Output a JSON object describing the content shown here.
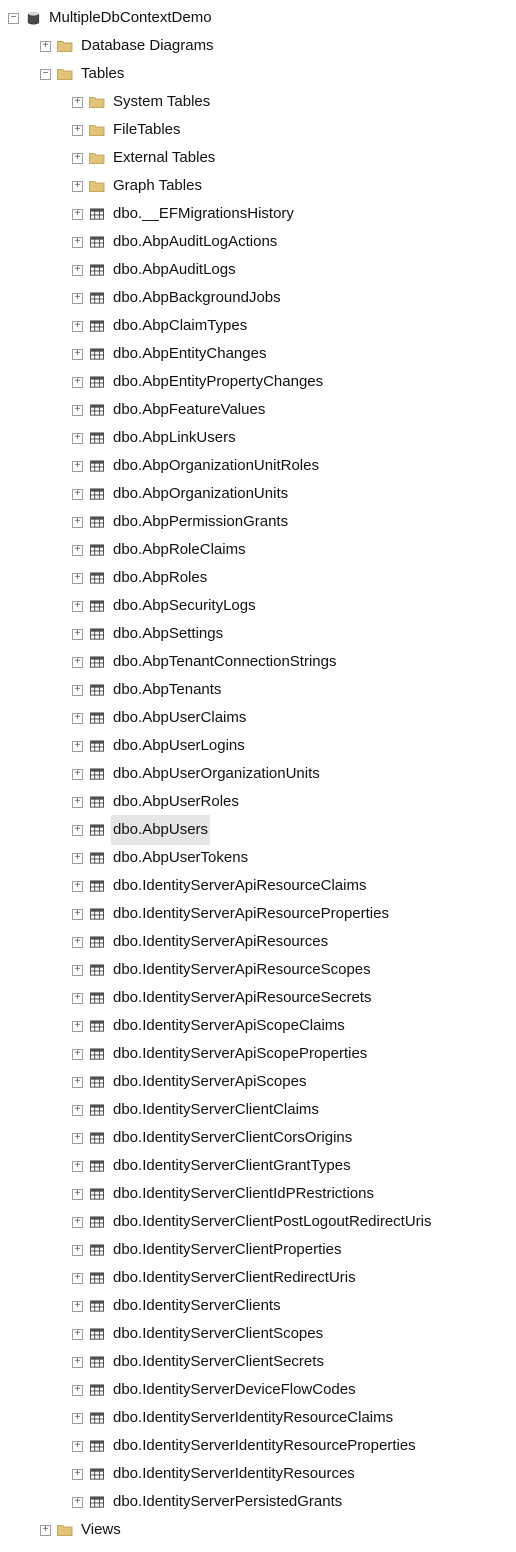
{
  "root": {
    "label": "MultipleDbContextDemo",
    "expanded": true,
    "icon": "database"
  },
  "level1": [
    {
      "label": "Database Diagrams",
      "icon": "folder",
      "expanded": false
    },
    {
      "label": "Tables",
      "icon": "folder",
      "expanded": true
    },
    {
      "label": "Views",
      "icon": "folder",
      "expanded": false
    }
  ],
  "tables_children": [
    {
      "label": "System Tables",
      "icon": "folder"
    },
    {
      "label": "FileTables",
      "icon": "folder"
    },
    {
      "label": "External Tables",
      "icon": "folder"
    },
    {
      "label": "Graph Tables",
      "icon": "folder"
    },
    {
      "label": "dbo.__EFMigrationsHistory",
      "icon": "table"
    },
    {
      "label": "dbo.AbpAuditLogActions",
      "icon": "table"
    },
    {
      "label": "dbo.AbpAuditLogs",
      "icon": "table"
    },
    {
      "label": "dbo.AbpBackgroundJobs",
      "icon": "table"
    },
    {
      "label": "dbo.AbpClaimTypes",
      "icon": "table"
    },
    {
      "label": "dbo.AbpEntityChanges",
      "icon": "table"
    },
    {
      "label": "dbo.AbpEntityPropertyChanges",
      "icon": "table"
    },
    {
      "label": "dbo.AbpFeatureValues",
      "icon": "table"
    },
    {
      "label": "dbo.AbpLinkUsers",
      "icon": "table"
    },
    {
      "label": "dbo.AbpOrganizationUnitRoles",
      "icon": "table"
    },
    {
      "label": "dbo.AbpOrganizationUnits",
      "icon": "table"
    },
    {
      "label": "dbo.AbpPermissionGrants",
      "icon": "table"
    },
    {
      "label": "dbo.AbpRoleClaims",
      "icon": "table"
    },
    {
      "label": "dbo.AbpRoles",
      "icon": "table"
    },
    {
      "label": "dbo.AbpSecurityLogs",
      "icon": "table"
    },
    {
      "label": "dbo.AbpSettings",
      "icon": "table"
    },
    {
      "label": "dbo.AbpTenantConnectionStrings",
      "icon": "table"
    },
    {
      "label": "dbo.AbpTenants",
      "icon": "table"
    },
    {
      "label": "dbo.AbpUserClaims",
      "icon": "table"
    },
    {
      "label": "dbo.AbpUserLogins",
      "icon": "table"
    },
    {
      "label": "dbo.AbpUserOrganizationUnits",
      "icon": "table"
    },
    {
      "label": "dbo.AbpUserRoles",
      "icon": "table"
    },
    {
      "label": "dbo.AbpUsers",
      "icon": "table",
      "selected": true
    },
    {
      "label": "dbo.AbpUserTokens",
      "icon": "table"
    },
    {
      "label": "dbo.IdentityServerApiResourceClaims",
      "icon": "table"
    },
    {
      "label": "dbo.IdentityServerApiResourceProperties",
      "icon": "table"
    },
    {
      "label": "dbo.IdentityServerApiResources",
      "icon": "table"
    },
    {
      "label": "dbo.IdentityServerApiResourceScopes",
      "icon": "table"
    },
    {
      "label": "dbo.IdentityServerApiResourceSecrets",
      "icon": "table"
    },
    {
      "label": "dbo.IdentityServerApiScopeClaims",
      "icon": "table"
    },
    {
      "label": "dbo.IdentityServerApiScopeProperties",
      "icon": "table"
    },
    {
      "label": "dbo.IdentityServerApiScopes",
      "icon": "table"
    },
    {
      "label": "dbo.IdentityServerClientClaims",
      "icon": "table"
    },
    {
      "label": "dbo.IdentityServerClientCorsOrigins",
      "icon": "table"
    },
    {
      "label": "dbo.IdentityServerClientGrantTypes",
      "icon": "table"
    },
    {
      "label": "dbo.IdentityServerClientIdPRestrictions",
      "icon": "table"
    },
    {
      "label": "dbo.IdentityServerClientPostLogoutRedirectUris",
      "icon": "table"
    },
    {
      "label": "dbo.IdentityServerClientProperties",
      "icon": "table"
    },
    {
      "label": "dbo.IdentityServerClientRedirectUris",
      "icon": "table"
    },
    {
      "label": "dbo.IdentityServerClients",
      "icon": "table"
    },
    {
      "label": "dbo.IdentityServerClientScopes",
      "icon": "table"
    },
    {
      "label": "dbo.IdentityServerClientSecrets",
      "icon": "table"
    },
    {
      "label": "dbo.IdentityServerDeviceFlowCodes",
      "icon": "table"
    },
    {
      "label": "dbo.IdentityServerIdentityResourceClaims",
      "icon": "table"
    },
    {
      "label": "dbo.IdentityServerIdentityResourceProperties",
      "icon": "table"
    },
    {
      "label": "dbo.IdentityServerIdentityResources",
      "icon": "table"
    },
    {
      "label": "dbo.IdentityServerPersistedGrants",
      "icon": "table"
    }
  ]
}
